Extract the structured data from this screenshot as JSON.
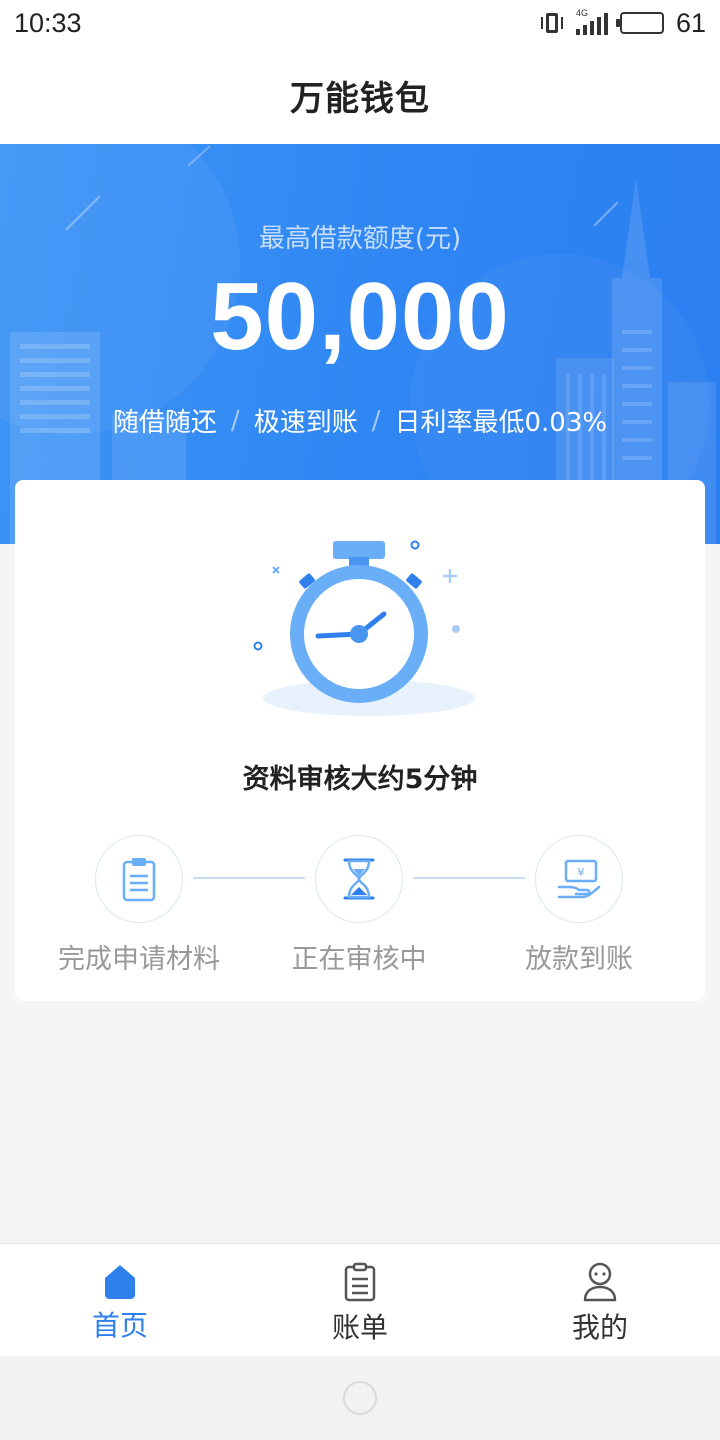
{
  "status": {
    "time": "10:33",
    "network_tag": "4G",
    "battery_level": "61",
    "battery_fraction": 0.61,
    "icons": [
      "vibrate-icon",
      "signal-icon",
      "battery-icon"
    ]
  },
  "header": {
    "title": "万能钱包"
  },
  "banner": {
    "quota_label": "最高借款额度(元)",
    "quota_value": "50,000",
    "features": [
      "随借随还",
      "极速到账",
      "日利率最低0.03%"
    ],
    "separator": "/"
  },
  "card": {
    "illustration_icon": "stopwatch-icon",
    "title": "资料审核大约5分钟",
    "steps": [
      {
        "label": "完成申请材料",
        "icon": "clipboard-icon"
      },
      {
        "label": "正在审核中",
        "icon": "hourglass-icon"
      },
      {
        "label": "放款到账",
        "icon": "money-hand-icon"
      }
    ]
  },
  "tabbar": {
    "items": [
      {
        "label": "首页",
        "icon": "home-icon",
        "active": true
      },
      {
        "label": "账单",
        "icon": "bill-icon",
        "active": false
      },
      {
        "label": "我的",
        "icon": "profile-icon",
        "active": false
      }
    ]
  },
  "colors": {
    "primary": "#2f80ed",
    "banner_start": "#3d95f6",
    "banner_end": "#2b7ef0",
    "background": "#f5f5f5",
    "muted_text": "#999999"
  }
}
